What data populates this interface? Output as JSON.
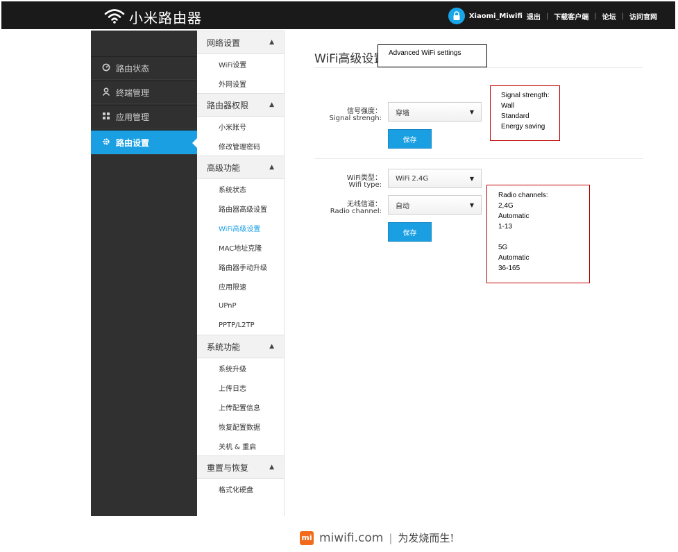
{
  "header": {
    "app_title": "小米路由器",
    "username": "Xiaomi_Miwifi",
    "links": [
      "退出",
      "下载客户端",
      "论坛",
      "访问官网"
    ]
  },
  "leftnav": {
    "items": [
      {
        "label": "路由状态",
        "icon": "gauge-icon"
      },
      {
        "label": "终端管理",
        "icon": "user-icon"
      },
      {
        "label": "应用管理",
        "icon": "grid-icon"
      },
      {
        "label": "路由设置",
        "icon": "gear-icon",
        "active": true
      }
    ]
  },
  "submenu": {
    "groups": [
      {
        "title": "网络设置",
        "items": [
          "WiFi设置",
          "外网设置"
        ]
      },
      {
        "title": "路由器权限",
        "items": [
          "小米账号",
          "修改管理密码"
        ]
      },
      {
        "title": "高级功能",
        "items": [
          "系统状态",
          "路由器高级设置",
          "WiFi高级设置",
          "MAC地址克隆",
          "路由器手动升级",
          "应用限速",
          "UPnP",
          "PPTP/L2TP"
        ]
      },
      {
        "title": "系统功能",
        "items": [
          "系统升级",
          "上传日志",
          "上传配置信息",
          "恢复配置数据",
          "关机 & 重启"
        ]
      },
      {
        "title": "重置与恢复",
        "items": [
          "格式化硬盘"
        ]
      }
    ],
    "current": "WiFi高级设置"
  },
  "main": {
    "title": "WiFi高级设置",
    "title_note": "Advanced WiFi settings",
    "signal": {
      "label_cn": "信号强度：",
      "label_en": "Signal strengh:",
      "value": "穿墙",
      "save_label": "保存",
      "note_lines": [
        "Signal strength:",
        "Wall",
        "Standard",
        "Energy saving"
      ]
    },
    "wifi_type": {
      "label_cn": "WiFi类型：",
      "label_en": "Wifi type:",
      "value": "WiFi 2.4G"
    },
    "channel": {
      "label_cn": "无线信道：",
      "label_en": "Radio channel:",
      "value": "自动",
      "save_label": "保存",
      "note_lines": [
        "Radio channels:",
        "2,4G",
        "Automatic",
        "1-13",
        "",
        "5G",
        "Automatic",
        "36-165"
      ]
    }
  },
  "footer": {
    "logo_text": "mi",
    "domain": "miwifi.com",
    "separator": "|",
    "slogan": "为发烧而生!"
  },
  "colors": {
    "accent": "#1a9fe3",
    "topbar": "#1a1a1a",
    "sidebar": "#303030",
    "note_border": "#c00000",
    "brand_orange": "#f26b1d"
  }
}
